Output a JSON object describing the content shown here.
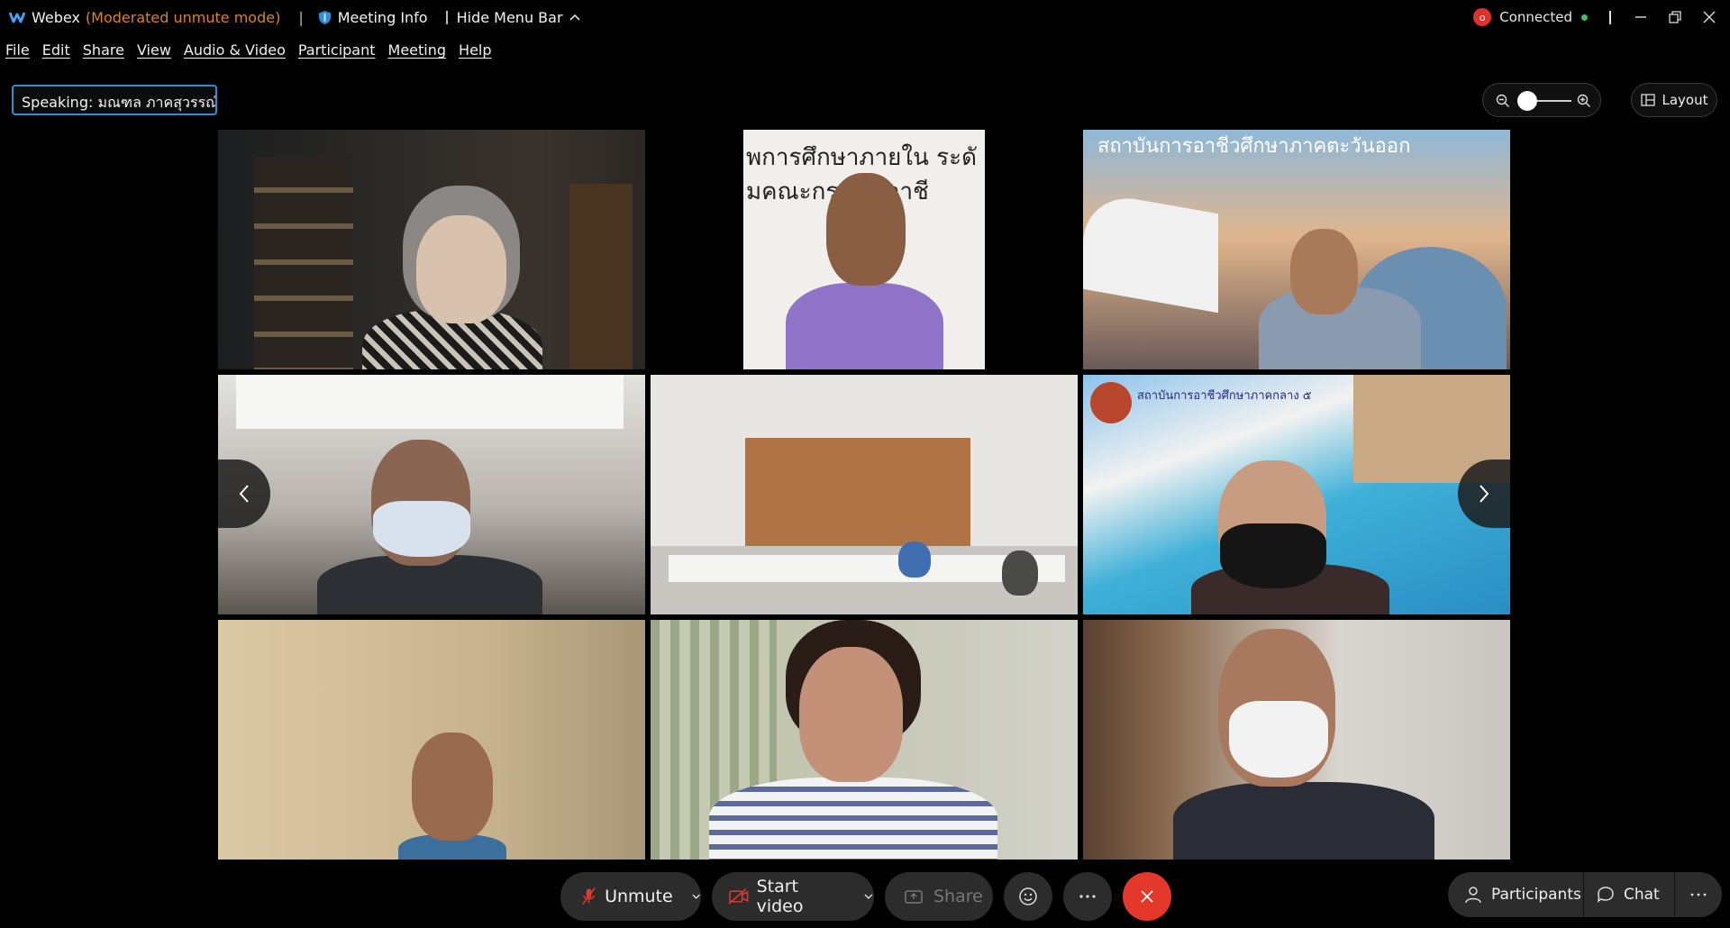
{
  "titlebar": {
    "app_name": "Webex",
    "mode": "(Moderated unmute mode)",
    "separator": "|",
    "meeting_info": "Meeting Info",
    "hide_menu_bar": "Hide Menu Bar",
    "connection_badge": "o",
    "connection_status": "Connected",
    "window_controls": [
      "minimize-icon",
      "restore-icon",
      "close-icon"
    ]
  },
  "menu": {
    "items": [
      "File",
      "Edit",
      "Share",
      "View",
      "Audio & Video",
      "Participant",
      "Meeting",
      "Help"
    ]
  },
  "speaking": {
    "label": "Speaking: มณฑล ภาคสุวรรณ์"
  },
  "toolbar": {
    "layout_label": "Layout"
  },
  "video_tiles": [
    {
      "id": "tile-1",
      "banner": ""
    },
    {
      "id": "tile-2",
      "banner_line1": "พการศึกษาภายใน ระดั",
      "banner_line2": "มคณะกร          การอาชี"
    },
    {
      "id": "tile-3",
      "banner": "สถาบันการอาชีวศึกษาภาคตะวันออก"
    },
    {
      "id": "tile-4",
      "banner": ""
    },
    {
      "id": "tile-5",
      "banner": ""
    },
    {
      "id": "tile-6",
      "banner": "สถาบันการอาชีวศึกษาภาคกลาง ๕"
    },
    {
      "id": "tile-7",
      "banner": ""
    },
    {
      "id": "tile-8",
      "banner": ""
    },
    {
      "id": "tile-9",
      "banner": ""
    }
  ],
  "controls": {
    "unmute_label": "Unmute",
    "start_video_label": "Start video",
    "share_label": "Share",
    "participants_label": "Participants",
    "chat_label": "Chat"
  },
  "colors": {
    "accent_blue": "#2e8fd6",
    "mode_orange": "#d9822b",
    "end_red": "#e4382b",
    "connected_green": "#3ec25b"
  }
}
